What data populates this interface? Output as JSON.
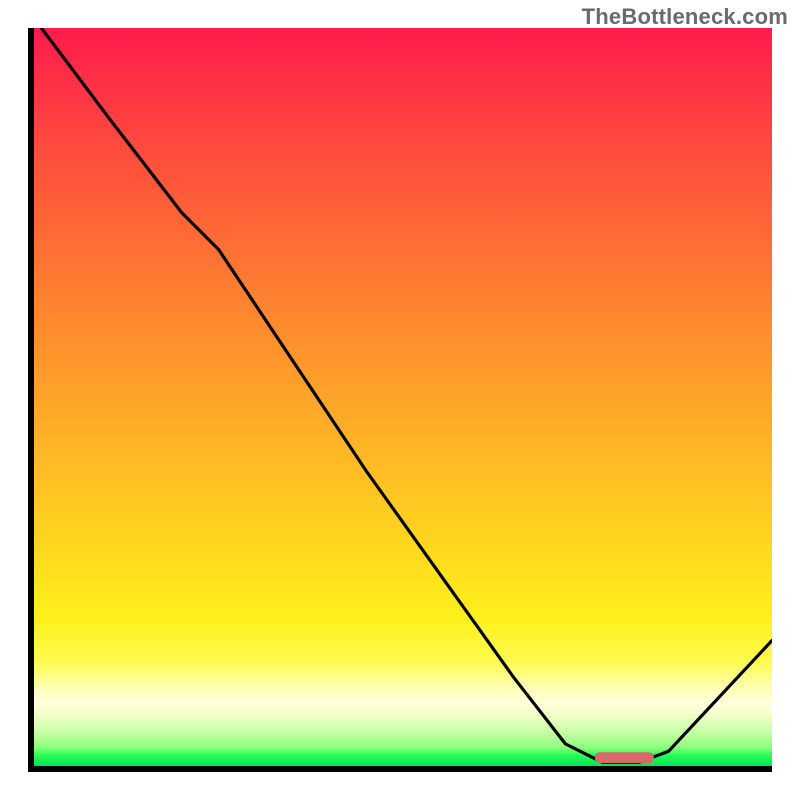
{
  "watermark": "TheBottleneck.com",
  "chart_data": {
    "type": "line",
    "title": "",
    "xlabel": "",
    "ylabel": "",
    "xlim": [
      0,
      100
    ],
    "ylim": [
      0,
      100
    ],
    "grid": false,
    "series": [
      {
        "name": "bottleneck-curve",
        "x": [
          1,
          10,
          20,
          25,
          35,
          45,
          55,
          65,
          72,
          77,
          82,
          86,
          100
        ],
        "y": [
          100,
          88,
          75,
          70,
          55,
          40,
          26,
          12,
          3,
          0.5,
          0.5,
          2,
          17
        ]
      }
    ],
    "annotations": [
      {
        "name": "optimal-range-marker",
        "x_start": 76,
        "x_end": 84,
        "y": 1.2,
        "color": "#d66a6a"
      }
    ],
    "colors": {
      "line": "#000000",
      "gradient_top": "#ff1a4d",
      "gradient_mid": "#ffd21f",
      "gradient_bottom": "#00e05a",
      "marker": "#d66a6a"
    }
  }
}
